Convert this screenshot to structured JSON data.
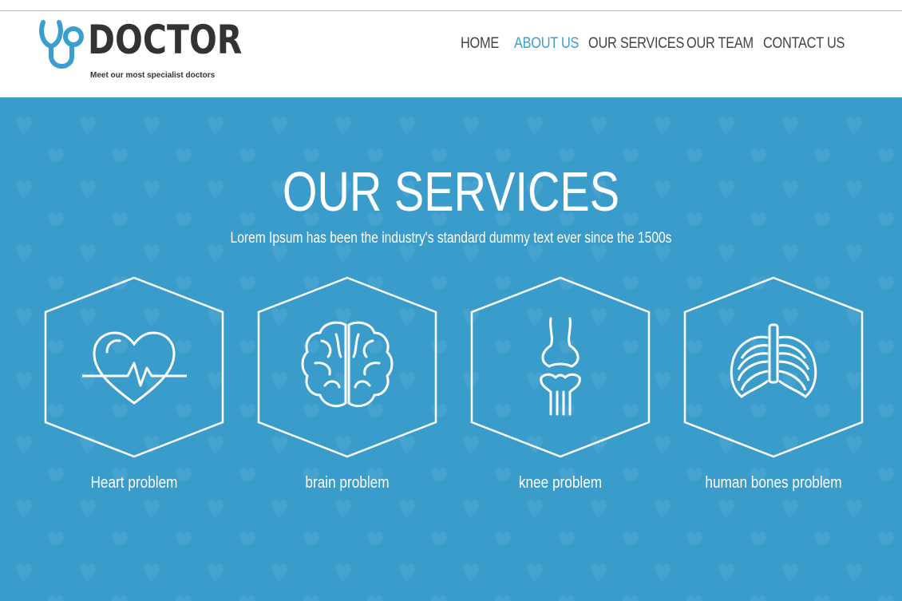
{
  "brand": {
    "name": "DOCTOR",
    "tagline": "Meet our most specialist doctors",
    "accent": "#3a9fcf"
  },
  "nav": {
    "items": [
      {
        "label": "HOME",
        "active": false
      },
      {
        "label": "ABOUT US",
        "active": true
      },
      {
        "label": "OUR SERVICES",
        "active": false
      },
      {
        "label": "OUR TEAM",
        "active": false
      },
      {
        "label": "CONTACT US",
        "active": false
      }
    ]
  },
  "hero": {
    "title": "OUR SERVICES",
    "subtitle": "Lorem Ipsum has been the industry's standard dummy text ever since the 1500s",
    "background": "#3a9ccb"
  },
  "services": [
    {
      "label": "Heart problem",
      "icon": "heart-pulse-icon"
    },
    {
      "label": "brain problem",
      "icon": "brain-icon"
    },
    {
      "label": "knee problem",
      "icon": "knee-joint-icon"
    },
    {
      "label": "human bones problem",
      "icon": "rib-cage-icon"
    }
  ]
}
